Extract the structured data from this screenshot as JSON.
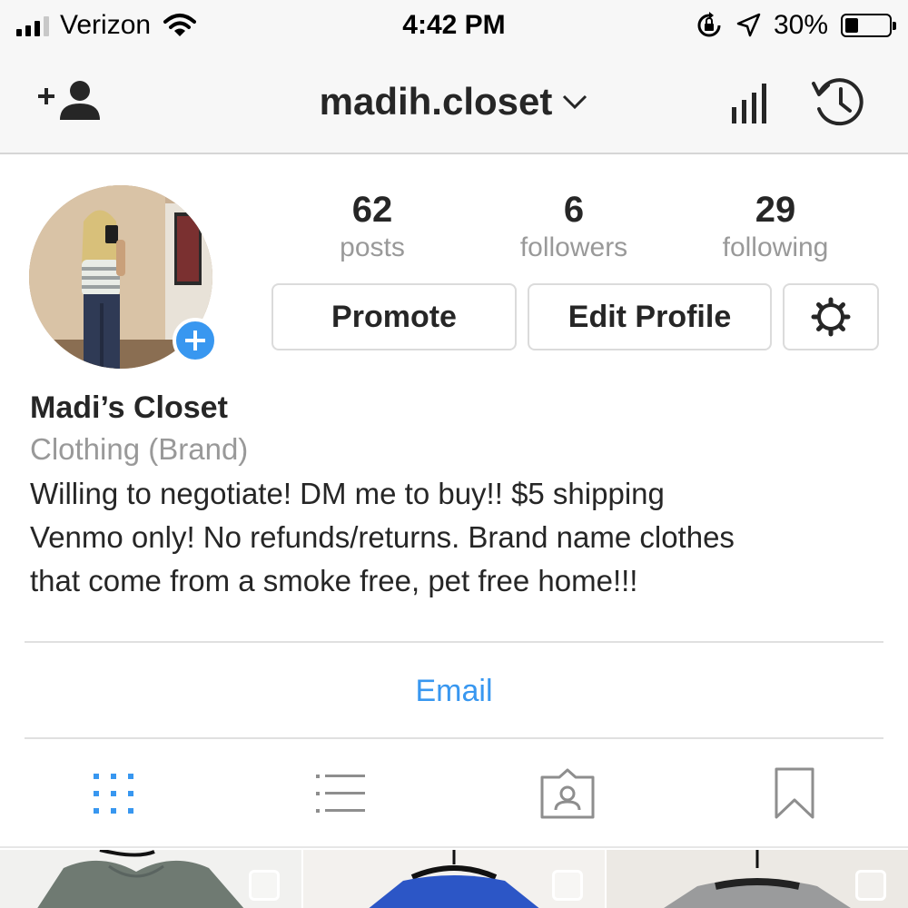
{
  "status_bar": {
    "carrier": "Verizon",
    "time": "4:42 PM",
    "battery_percent": "30%",
    "battery_level": 0.3,
    "icons": [
      "signal-icon",
      "wifi-icon",
      "rotation-lock-icon",
      "location-arrow-icon",
      "battery-icon"
    ]
  },
  "nav": {
    "username": "madih.closet",
    "icons": [
      "add-person-icon",
      "chevron-down-icon",
      "insights-icon",
      "archive-clock-icon"
    ]
  },
  "profile": {
    "stats": [
      {
        "count": "62",
        "label": "posts"
      },
      {
        "count": "6",
        "label": "followers"
      },
      {
        "count": "29",
        "label": "following"
      }
    ],
    "buttons": {
      "promote": "Promote",
      "edit_profile": "Edit Profile"
    },
    "name": "Madi’s Closet",
    "category": "Clothing (Brand)",
    "bio_lines": [
      "Willing to negotiate! DM me to buy!! $5 shipping",
      "Venmo only! No refunds/returns. Brand name clothes",
      "that come from a smoke free, pet free home!!!"
    ],
    "contact": "Email"
  },
  "tabs": [
    "grid-icon",
    "list-icon",
    "tagged-icon",
    "saved-icon"
  ],
  "colors": {
    "accent_blue": "#3897f0",
    "text_primary": "#262626",
    "text_secondary": "#999999",
    "bar_background": "#f7f7f7",
    "border": "#dbdbdb"
  }
}
